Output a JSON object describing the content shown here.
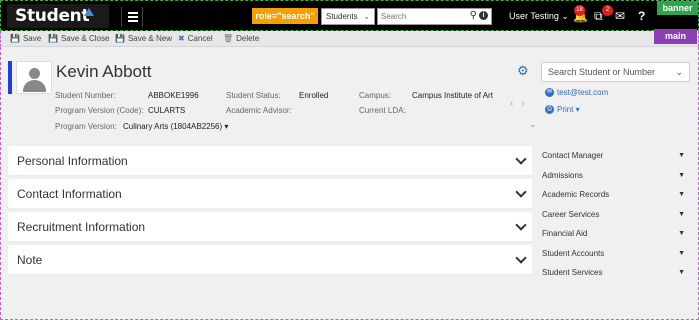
{
  "banner": {
    "brand": "Student",
    "role_tag": "role=\"search\"",
    "scope_select": "Students",
    "search_placeholder": "Search",
    "user": "User Testing",
    "notifications_count": "18",
    "tasks_count": "2",
    "banner_label": "banner"
  },
  "toolbar": {
    "save": "Save",
    "save_close": "Save & Close",
    "save_new": "Save & New",
    "cancel": "Cancel",
    "delete": "Delete",
    "main_label": "main"
  },
  "student": {
    "name": "Kevin Abbott",
    "fields": {
      "student_number_label": "Student Number:",
      "student_number": "ABBOKE1996",
      "student_status_label": "Student Status:",
      "student_status": "Enrolled",
      "campus_label": "Campus:",
      "campus": "Campus Institute of Art",
      "program_version_code_label": "Program Version (Code):",
      "program_version_code": "CULARTS",
      "academic_advisor_label": "Academic Advisor:",
      "current_lda_label": "Current LDA:",
      "program_version_label": "Program Version:",
      "program_version": "Culinary Arts (1804AB2256)"
    }
  },
  "accordion": [
    {
      "title": "Personal Information"
    },
    {
      "title": "Contact Information"
    },
    {
      "title": "Recruitment Information"
    },
    {
      "title": "Note"
    }
  ],
  "sidebar": {
    "search_placeholder": "Search Student or Number",
    "email": "test@test.com",
    "print": "Print",
    "items": [
      {
        "label": "Contact Manager"
      },
      {
        "label": "Admissions"
      },
      {
        "label": "Academic Records"
      },
      {
        "label": "Career Services"
      },
      {
        "label": "Financial Aid"
      },
      {
        "label": "Student Accounts"
      },
      {
        "label": "Student Services"
      }
    ]
  },
  "colors": {
    "accent": "#2f6fc4",
    "role_tag": "#f5a000",
    "banner_tag": "#2ea44f",
    "main_tag": "#8a3fb5",
    "badge": "#e02020"
  }
}
